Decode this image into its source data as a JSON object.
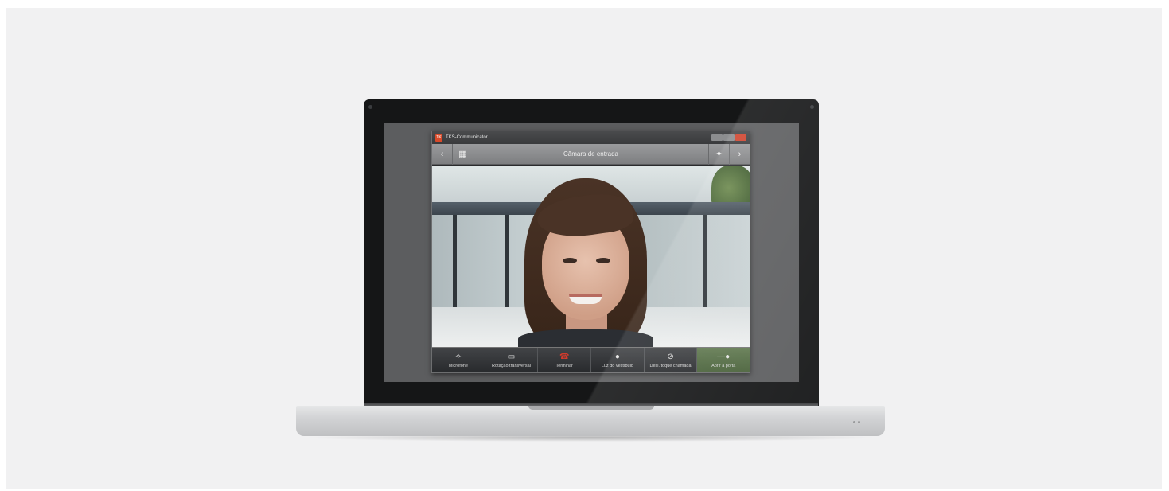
{
  "window": {
    "app_title": "TKS-Communicator",
    "toolbar_title": "Câmara de entrada",
    "logo_text": "TK"
  },
  "icons": {
    "back": "chevron-left-icon",
    "camera": "camera-icon",
    "settings": "wrench-icon",
    "next": "chevron-right-icon"
  },
  "controls": [
    {
      "label": "Microfone",
      "icon": "microphone-icon",
      "glyph": "✧"
    },
    {
      "label": "Rotação transversal",
      "icon": "camera-pan-icon",
      "glyph": "▭"
    },
    {
      "label": "Terminar",
      "icon": "hangup-icon",
      "glyph": "☎"
    },
    {
      "label": "Luz do vestíbulo",
      "icon": "light-bulb-icon",
      "glyph": "●"
    },
    {
      "label": "Desl. toque chamada",
      "icon": "mute-bell-icon",
      "glyph": "⊘"
    },
    {
      "label": "Abrir a porta",
      "icon": "door-key-icon",
      "glyph": "—●"
    }
  ],
  "colors": {
    "hangup": "#d43b2c",
    "close": "#d0452f",
    "active": "#6f9a4f"
  }
}
